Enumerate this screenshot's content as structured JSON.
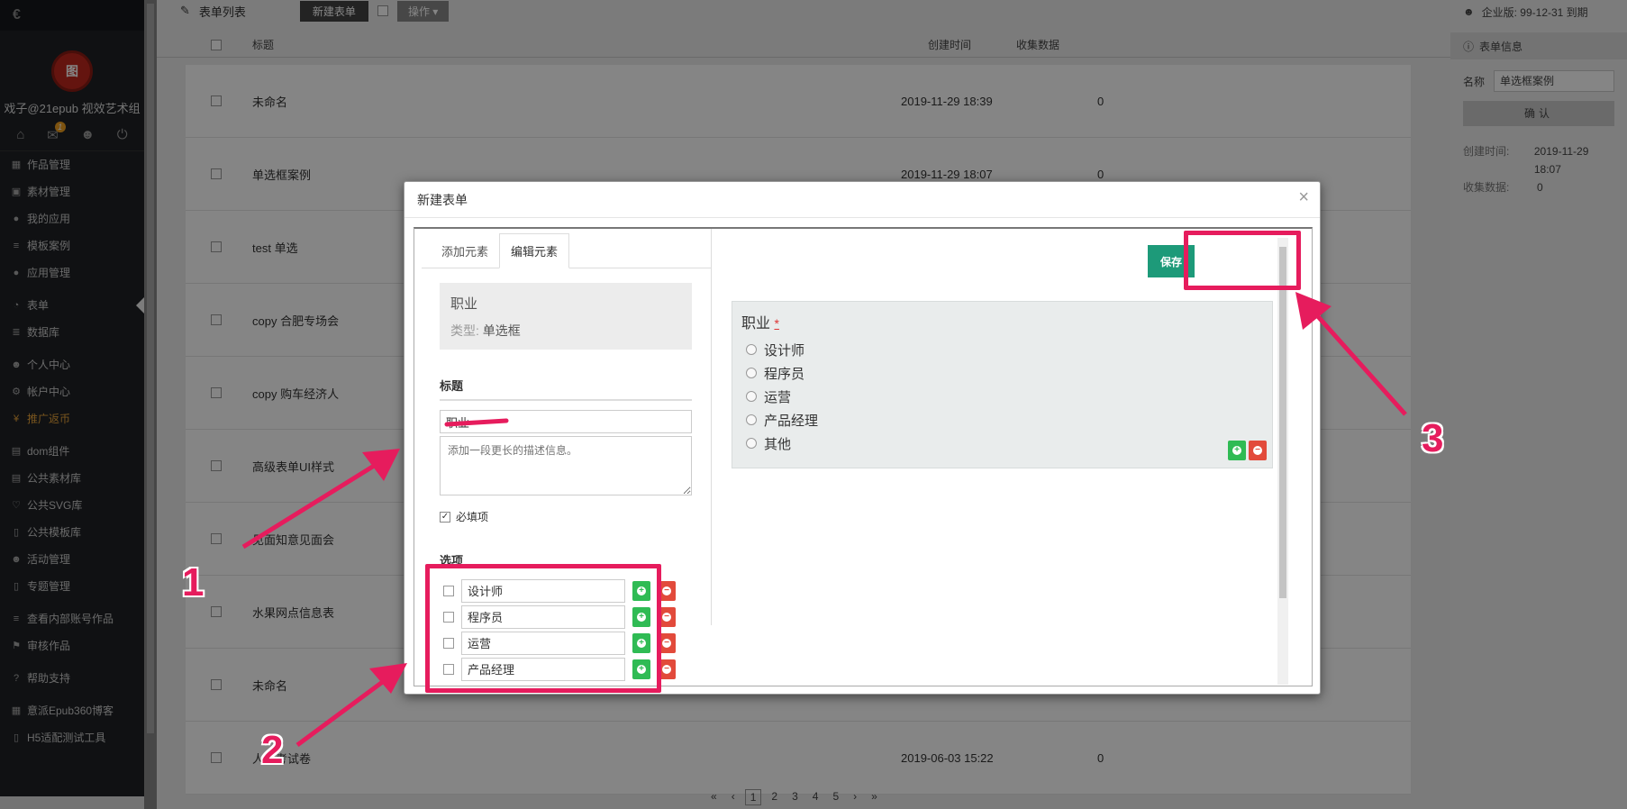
{
  "sidebar": {
    "brand_glyph": "€",
    "logo_text": "图",
    "username": "戏子@21epub 视效艺术组",
    "message_badge": "1",
    "menu": [
      {
        "label": "作品管理",
        "icon": "grid-icon"
      },
      {
        "label": "素材管理",
        "icon": "image-icon"
      },
      {
        "label": "我的应用",
        "icon": "circle-icon"
      },
      {
        "label": "模板案例",
        "icon": "list-icon"
      },
      {
        "label": "应用管理",
        "icon": "circle-icon"
      },
      {
        "label": "表单",
        "icon": "pie-chart-icon"
      },
      {
        "label": "数据库",
        "icon": "database-icon"
      },
      {
        "label": "个人中心",
        "icon": "user-icon"
      },
      {
        "label": "帐户中心",
        "icon": "gear-icon"
      },
      {
        "label": "推广返币",
        "icon": "yen-icon"
      },
      {
        "label": "dom组件",
        "icon": "briefcase-icon"
      },
      {
        "label": "公共素材库",
        "icon": "briefcase-icon"
      },
      {
        "label": "公共SVG库",
        "icon": "heart-icon"
      },
      {
        "label": "公共模板库",
        "icon": "book-icon"
      },
      {
        "label": "活动管理",
        "icon": "users-icon"
      },
      {
        "label": "专题管理",
        "icon": "book-icon"
      },
      {
        "label": "查看内部账号作品",
        "icon": "list-icon"
      },
      {
        "label": "审核作品",
        "icon": "flag-icon"
      },
      {
        "label": "帮助支持",
        "icon": "question-icon"
      },
      {
        "label": "意派Epub360博客",
        "icon": "grid-icon"
      },
      {
        "label": "H5适配测试工具",
        "icon": "mobile-icon"
      }
    ]
  },
  "main": {
    "list_title": "表单列表",
    "new_form_button": "新建表单",
    "action_button": "操作",
    "columns": [
      "标题",
      "创建时间",
      "收集数据"
    ],
    "rows": [
      {
        "title": "未命名",
        "created": "2019-11-29 18:39",
        "count": "0"
      },
      {
        "title": "单选框案例",
        "created": "2019-11-29 18:07",
        "count": "0"
      },
      {
        "title": "test 单选",
        "created": "",
        "count": ""
      },
      {
        "title": "copy 合肥专场会",
        "created": "",
        "count": ""
      },
      {
        "title": "copy 购车经济人",
        "created": "",
        "count": ""
      },
      {
        "title": "高级表单UI样式",
        "created": "",
        "count": ""
      },
      {
        "title": "见面知意见面会",
        "created": "",
        "count": ""
      },
      {
        "title": "水果网点信息表",
        "created": "",
        "count": ""
      },
      {
        "title": "未命名",
        "created": "",
        "count": ""
      },
      {
        "title": "人高考试卷",
        "created": "2019-06-03 15:22",
        "count": "0"
      }
    ],
    "pager": [
      "«",
      "‹",
      "1",
      "2",
      "3",
      "4",
      "5",
      "›",
      "»"
    ]
  },
  "info": {
    "license": "企业版: 99-12-31 到期",
    "header": "表单信息",
    "name_label": "名称",
    "name_value": "单选框案例",
    "confirm": "确认",
    "created_label": "创建时间:",
    "created_value": "2019-11-29 18:07",
    "collected_label": "收集数据:",
    "collected_value": "0"
  },
  "modal": {
    "title": "新建表单",
    "close": "×",
    "tabs": [
      "添加元素",
      "编辑元素"
    ],
    "element_name": "职业",
    "element_type_label": "类型:",
    "element_type": "单选框",
    "title_section": "标题",
    "title_value": "职业",
    "desc_placeholder": "添加一段更长的描述信息。",
    "required_label": "必填项",
    "options_section": "选项",
    "options": [
      "设计师",
      "程序员",
      "运营",
      "产品经理"
    ],
    "save": "保存",
    "preview_title": "职业",
    "preview_required_mark": "*",
    "preview_options": [
      "设计师",
      "程序员",
      "运营",
      "产品经理",
      "其他"
    ]
  },
  "annotations": {
    "labels": [
      "1",
      "2",
      "3"
    ],
    "color": "#e61c5d"
  }
}
